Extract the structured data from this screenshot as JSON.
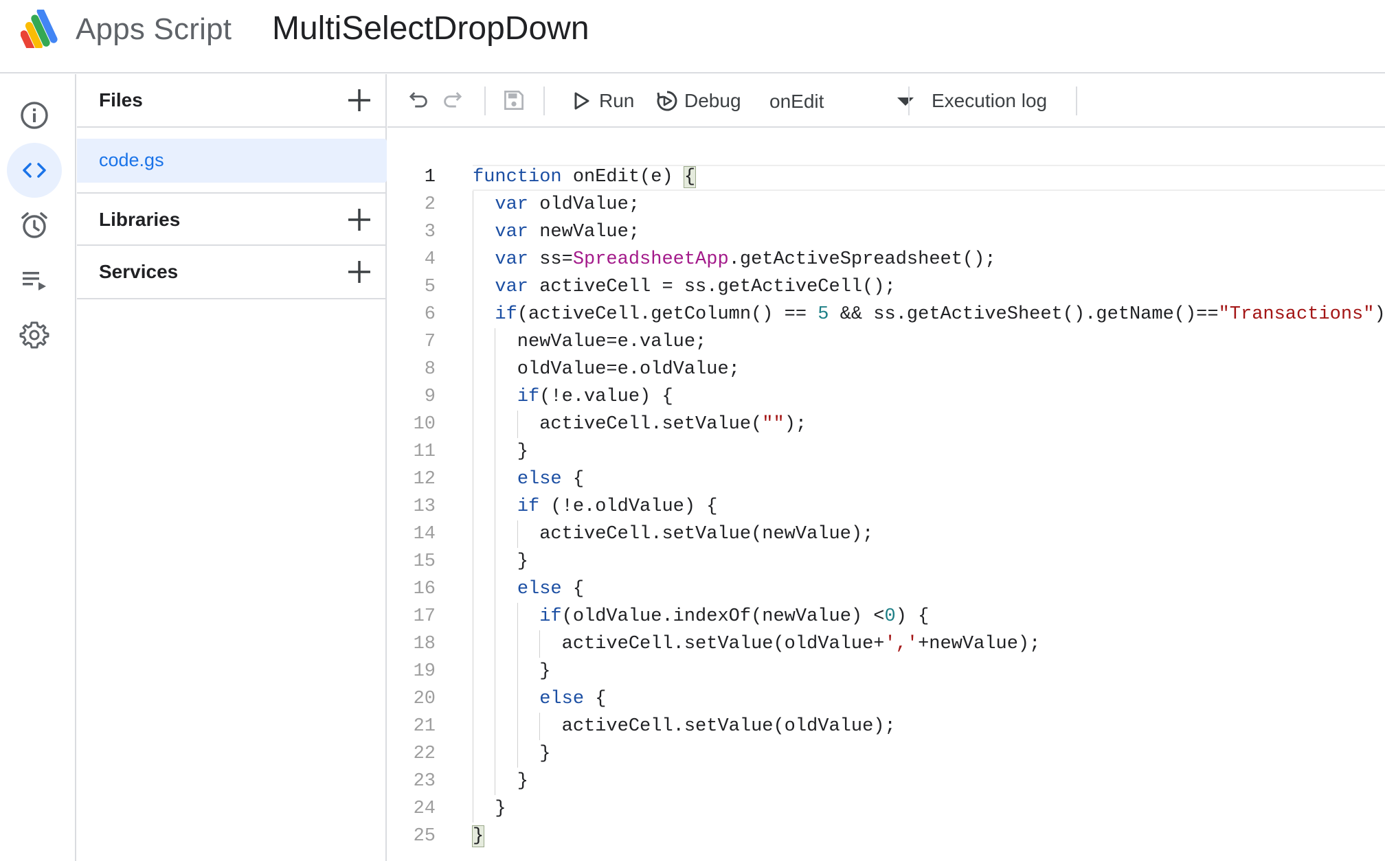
{
  "header": {
    "app_name": "Apps Script",
    "project_title": "MultiSelectDropDown"
  },
  "rail": {
    "items": [
      {
        "name": "overview",
        "icon": "info-icon",
        "active": false
      },
      {
        "name": "editor",
        "icon": "code-icon",
        "active": true
      },
      {
        "name": "triggers",
        "icon": "alarm-clock-icon",
        "active": false
      },
      {
        "name": "executions",
        "icon": "playlist-play-icon",
        "active": false
      },
      {
        "name": "settings",
        "icon": "gear-icon",
        "active": false
      }
    ]
  },
  "files_panel": {
    "files_label": "Files",
    "files": [
      "code.gs"
    ],
    "libraries_label": "Libraries",
    "services_label": "Services"
  },
  "toolbar": {
    "run_label": "Run",
    "debug_label": "Debug",
    "function_selected": "onEdit",
    "execution_log_label": "Execution log"
  },
  "code": {
    "active_line": 1,
    "lines": [
      "function onEdit(e) {",
      "  var oldValue;",
      "  var newValue;",
      "  var ss=SpreadsheetApp.getActiveSpreadsheet();",
      "  var activeCell = ss.getActiveCell();",
      "  if(activeCell.getColumn() == 5 && ss.getActiveSheet().getName()==\"Transactions\")",
      "    newValue=e.value;",
      "    oldValue=e.oldValue;",
      "    if(!e.value) {",
      "      activeCell.setValue(\"\");",
      "    }",
      "    else {",
      "    if (!e.oldValue) {",
      "      activeCell.setValue(newValue);",
      "    }",
      "    else {",
      "      if(oldValue.indexOf(newValue) <0) {",
      "        activeCell.setValue(oldValue+','+newValue);",
      "      }",
      "      else {",
      "        activeCell.setValue(oldValue);",
      "      }",
      "    }",
      "  }",
      "}"
    ]
  },
  "colors": {
    "accent": "#1a73e8",
    "keyword": "#1c4fa3",
    "class_name": "#a31a8a",
    "string": "#a31515",
    "number": "#1d7f86",
    "active_bg": "#e8f0fe"
  }
}
